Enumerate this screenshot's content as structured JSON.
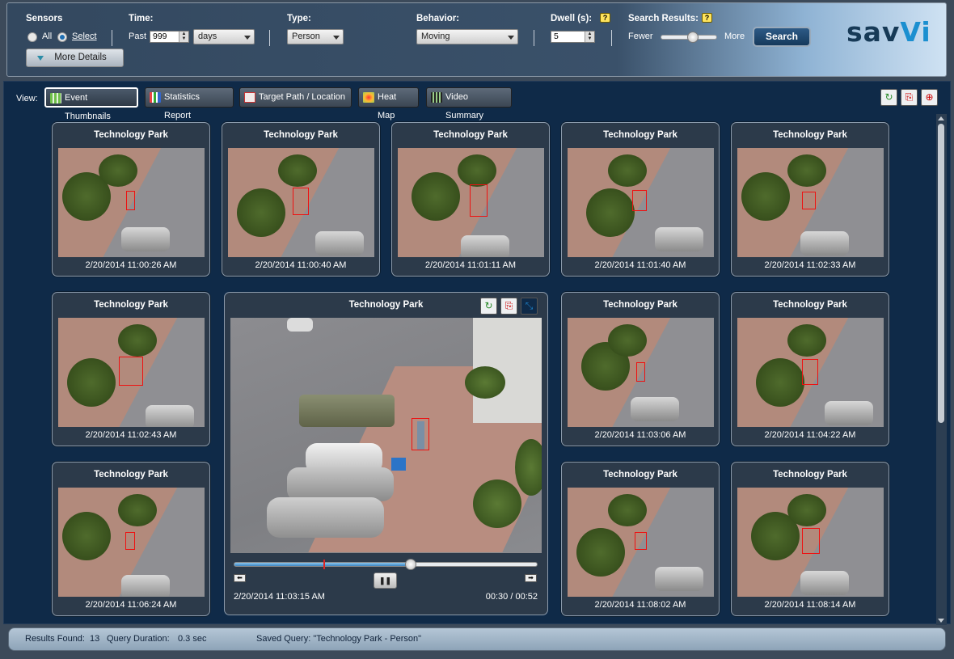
{
  "toolbar": {
    "sensors_label": "Sensors",
    "sensors_all": "All",
    "sensors_select": "Select",
    "time_label": "Time:",
    "past_label": "Past",
    "past_value": "999",
    "period": "days",
    "type_label": "Type:",
    "type_value": "Person",
    "behavior_label": "Behavior:",
    "behavior_value": "Moving",
    "dwell_label": "Dwell (s):",
    "dwell_value": "5",
    "search_results_label": "Search Results:",
    "fewer": "Fewer",
    "more": "More",
    "results_slider_level": 0.55,
    "search_button": "Search",
    "more_details": "More Details",
    "help_glyph": "?",
    "logo_a": "sav",
    "logo_b": "Vi"
  },
  "view": {
    "label": "View:",
    "buttons": [
      "Event Thumbnails",
      "Statistics Report",
      "Target Path / Location",
      "Heat Map",
      "Video Summary"
    ]
  },
  "events": [
    {
      "title": "Technology Park",
      "time": "2/20/2014 11:00:26 AM"
    },
    {
      "title": "Technology Park",
      "time": "2/20/2014 11:00:40 AM"
    },
    {
      "title": "Technology Park",
      "time": "2/20/2014 11:01:11 AM"
    },
    {
      "title": "Technology Park",
      "time": "2/20/2014 11:01:40 AM"
    },
    {
      "title": "Technology Park",
      "time": "2/20/2014 11:02:33 AM"
    },
    {
      "title": "Technology Park",
      "time": "2/20/2014 11:02:43 AM"
    },
    {
      "title": "Technology Park",
      "time": "2/20/2014 11:03:06 AM"
    },
    {
      "title": "Technology Park",
      "time": "2/20/2014 11:04:22 AM"
    },
    {
      "title": "Technology Park",
      "time": "2/20/2014 11:06:24 AM"
    },
    {
      "title": "Technology Park",
      "time": "2/20/2014 11:08:02 AM"
    },
    {
      "title": "Technology Park",
      "time": "2/20/2014 11:08:14 AM"
    }
  ],
  "player": {
    "title": "Technology Park",
    "time": "2/20/2014 11:03:15 AM",
    "elapsed": "00:30 / 00:52",
    "progress": 0.58,
    "pause_glyph": "❚❚"
  },
  "status": {
    "results_label": "Results Found:",
    "results_value": "13",
    "duration_label": "Query Duration:",
    "duration_value": "0.3 sec",
    "saved_query": "Saved Query: \"Technology Park - Person\""
  }
}
